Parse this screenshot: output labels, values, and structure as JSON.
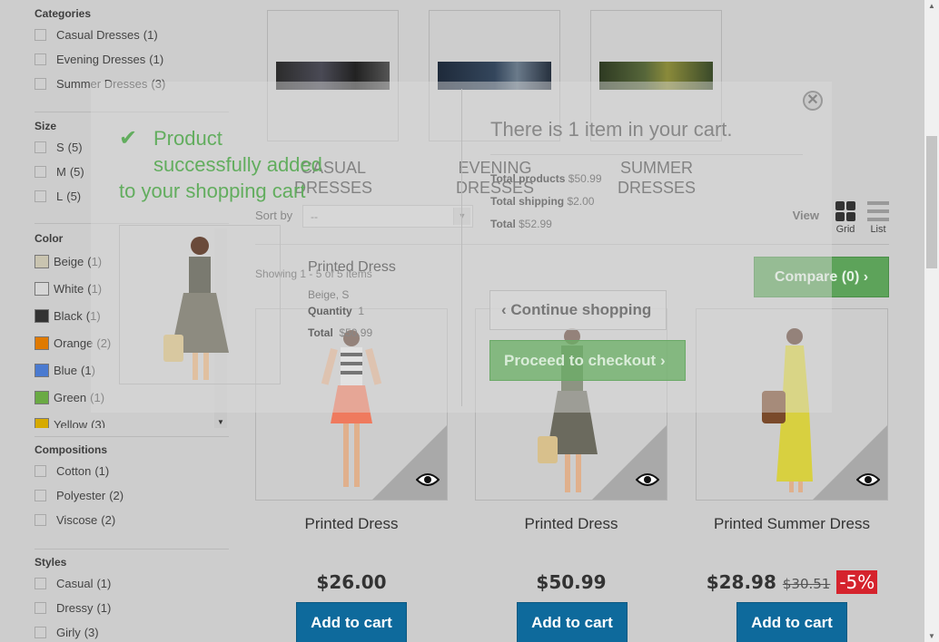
{
  "sidebar": {
    "categories": {
      "title": "Categories",
      "items": [
        {
          "label": "Casual Dresses",
          "count": "(1)"
        },
        {
          "label": "Evening Dresses",
          "count": "(1)"
        },
        {
          "label": "Summer Dresses",
          "count": "(3)"
        }
      ]
    },
    "size": {
      "title": "Size",
      "items": [
        {
          "label": "S",
          "count": "(5)"
        },
        {
          "label": "M",
          "count": "(5)"
        },
        {
          "label": "L",
          "count": "(5)"
        }
      ]
    },
    "color": {
      "title": "Color",
      "items": [
        {
          "label": "Beige",
          "count": "(1)",
          "swatch": "#c9c4b0"
        },
        {
          "label": "White",
          "count": "(1)",
          "swatch": "#d6d6d6"
        },
        {
          "label": "Black",
          "count": "(1)",
          "swatch": "#333333"
        },
        {
          "label": "Orange",
          "count": "(2)",
          "swatch": "#e07a00"
        },
        {
          "label": "Blue",
          "count": "(1)",
          "swatch": "#4a7ad0"
        },
        {
          "label": "Green",
          "count": "(1)",
          "swatch": "#6aaa44"
        },
        {
          "label": "Yellow",
          "count": "(3)",
          "swatch": "#d6aa00"
        }
      ]
    },
    "compositions": {
      "title": "Compositions",
      "items": [
        {
          "label": "Cotton",
          "count": "(1)"
        },
        {
          "label": "Polyester",
          "count": "(2)"
        },
        {
          "label": "Viscose",
          "count": "(2)"
        }
      ]
    },
    "styles": {
      "title": "Styles",
      "items": [
        {
          "label": "Casual",
          "count": "(1)"
        },
        {
          "label": "Dressy",
          "count": "(1)"
        },
        {
          "label": "Girly",
          "count": "(3)"
        }
      ]
    }
  },
  "subcategories": [
    {
      "line1": "CASUAL",
      "line2": "DRESSES"
    },
    {
      "line1": "EVENING",
      "line2": "DRESSES"
    },
    {
      "line1": "SUMMER",
      "line2": "DRESSES"
    }
  ],
  "toolbar": {
    "sort_label": "Sort by",
    "sort_value": "--",
    "view_label": "View",
    "grid_label": "Grid",
    "list_label": "List",
    "showing": "Showing 1 - 5 of 5 items",
    "compare_label": "Compare (0)"
  },
  "products": [
    {
      "name": "Printed Dress",
      "price": "$26.00",
      "add_label": "Add to cart"
    },
    {
      "name": "Printed Dress",
      "price": "$50.99",
      "add_label": "Add to cart"
    },
    {
      "name": "Printed Summer Dress",
      "price": "$28.98",
      "old_price": "$30.51",
      "discount": "-5%",
      "add_label": "Add to cart"
    }
  ],
  "modal": {
    "success_line1": "Product",
    "success_line2": "successfully added",
    "success_line3": "to your shopping cart",
    "product_name": "Printed Dress",
    "attributes": "Beige, S",
    "quantity_label": "Quantity",
    "quantity_value": "1",
    "total_label": "Total",
    "total_value": "$50.99",
    "cart_title": "There is 1 item in your cart.",
    "total_products_label": "Total products",
    "total_products_value": "$50.99",
    "total_shipping_label": "Total shipping",
    "total_shipping_value": "$2.00",
    "grand_total_label": "Total",
    "grand_total_value": "$52.99",
    "continue_label": "Continue shopping",
    "checkout_label": "Proceed to checkout",
    "close_symbol": "✕"
  },
  "icons": {
    "check": "check-icon",
    "close": "close-icon",
    "eye": "eye-icon",
    "chevron_left": "chevron-left-icon",
    "chevron_right": "chevron-right-icon"
  }
}
